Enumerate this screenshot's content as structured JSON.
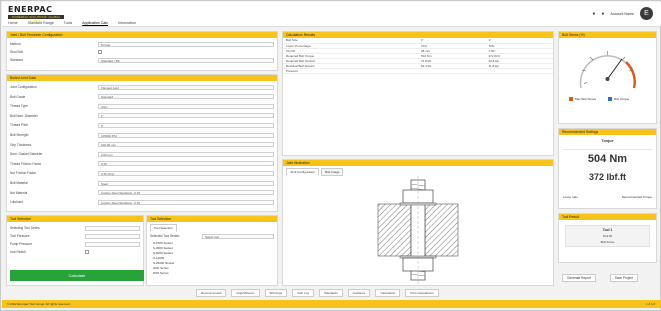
{
  "header": {
    "brand": "ENERPAC",
    "brand_tagline": "POWERFUL SOLUTIONS. GLOBAL FORCE.",
    "nav": [
      "Home",
      "Standard Range",
      "Tools",
      "Application Calc",
      "Information"
    ],
    "active_nav": 3,
    "user": "Account Name",
    "avatar": "E"
  },
  "bolt_panel": {
    "title": "Joint / Bolt Tensioner Configuration",
    "rows": [
      {
        "label": "Method",
        "value": "Torque"
      },
      {
        "label": "Stud Bolt",
        "value": ""
      },
      {
        "label": "Standard",
        "value": "Standard / BS"
      }
    ]
  },
  "joint_panel": {
    "title": "Bolted Joint Data",
    "rows": [
      {
        "label": "Joint Configuration",
        "value": "Flanged Joint"
      },
      {
        "label": "Bolt Grade",
        "value": "Standard"
      },
      {
        "label": "Thread Type",
        "value": "UNC"
      },
      {
        "label": "Bolt Nom. Diameter",
        "value": "1\""
      },
      {
        "label": "Thread Pitch",
        "value": "8"
      },
      {
        "label": "Bolt Strength",
        "value": "105000 PSI"
      },
      {
        "label": "Grip Thickness",
        "value": "100.00 mm"
      },
      {
        "label": "Nom. Gasket Diameter",
        "value": "0.00 mm"
      },
      {
        "label": "Thread Friction Factor",
        "value": "0.15"
      },
      {
        "label": "Nut Friction Factor",
        "value": "0.15 (Dry)"
      },
      {
        "label": "Bolt Material",
        "value": "Steel"
      },
      {
        "label": "Nut Material",
        "value": "Carbon Steel Standard - 0.15"
      },
      {
        "label": "Lubricant",
        "value": "Carbon Steel Standard - 0.15"
      }
    ]
  },
  "tool_panel": {
    "title": "Tool Selection",
    "rows": [
      {
        "label": "Selecting Tool Series",
        "value": ""
      },
      {
        "label": "Tool Pressure",
        "value": ""
      },
      {
        "label": "Pump Pressure",
        "value": ""
      },
      {
        "label": "Use Reach",
        "value": ""
      }
    ],
    "button": "Calculate"
  },
  "list_panel": {
    "title": "Tool Selection",
    "tab": "Tool Selection",
    "filter_label": "Selected Tool Series:",
    "filter_value": "Select tool",
    "items": [
      "S-1500 Socket",
      "S-3000 Socket",
      "S-6000 Socket",
      "S-11000",
      "S-25000 Socket",
      "HXD Series",
      "DSX Series"
    ]
  },
  "results_panel": {
    "title": "Calculation Results",
    "rows": [
      [
        "Bolt Size",
        "1\"",
        "1\""
      ],
      [
        "Load / Percentage",
        "70%",
        "70%"
      ],
      [
        "Tool ID",
        "38 mm",
        "1.50\""
      ],
      [
        "Required Bolt Torque",
        "504 Nm",
        "372 lbf.ft"
      ],
      [
        "Required Bolt Tension",
        "74.8 kN",
        "16.8 kip"
      ],
      [
        "Residual Bolt Tension",
        "52.4 kN",
        "11.8 kip"
      ],
      [
        "Pressure",
        "",
        ""
      ]
    ]
  },
  "graphic_panel": {
    "title": "Joint Illustration",
    "tabs": [
      "Joint Configuration",
      "Bolt Image"
    ]
  },
  "gauge_panel": {
    "title": "Bolt Stress (%)",
    "legend": [
      "Max Bolt Stress",
      "Bolt Torque"
    ]
  },
  "torque_panel": {
    "title": "Recommended Settings",
    "subtitle": "Torque",
    "value_nm": "504 Nm",
    "value_lbf": "372 lbf.ft",
    "footer_label": "Loose ratio",
    "footer_value": "Recommended Torque"
  },
  "tool_result_panel": {
    "title": "Tool Result",
    "lines": [
      "Tool 1",
      "Tool ID",
      "Bolt Force"
    ]
  },
  "actions": [
    "Generate Report",
    "Save Project"
  ],
  "bottombar": [
    "Recommended",
    "Graph/Report",
    "Warnings",
    "Calc Log",
    "Standards",
    "Guidance",
    "Calculation",
    "Print Calculations"
  ],
  "footer": {
    "copyright": "© 2022 Enerpac Tool Group. All rights reserved.",
    "version": "v 2.1.0"
  },
  "colors": {
    "accent": "#f7c31a",
    "button": "#27a33a"
  }
}
